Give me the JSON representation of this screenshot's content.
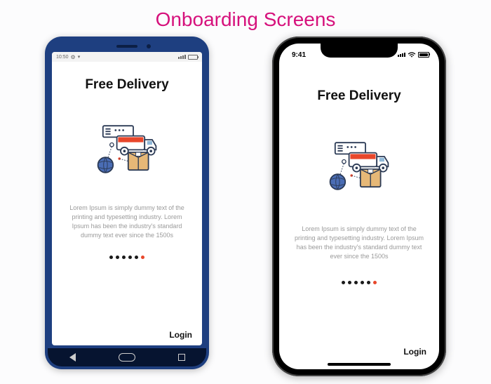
{
  "page": {
    "title": "Onboarding Screens"
  },
  "android": {
    "status": {
      "time": "10:50",
      "gear": "⚙",
      "wifi": "▾"
    },
    "heading": "Free Delivery",
    "desc": "Lorem Ipsum is simply dummy text of the printing and typesetting industry. Lorem Ipsum has been the industry's standard dummy text ever since the 1500s",
    "login": "Login"
  },
  "iphone": {
    "status": {
      "time": "9:41"
    },
    "heading": "Free Delivery",
    "desc": "Lorem Ipsum is simply dummy text of the printing and typesetting industry. Lorem Ipsum has been the industry's standard dummy text ever since the 1500s",
    "login": "Login"
  },
  "pager": {
    "total": 6,
    "active_index": 5
  }
}
